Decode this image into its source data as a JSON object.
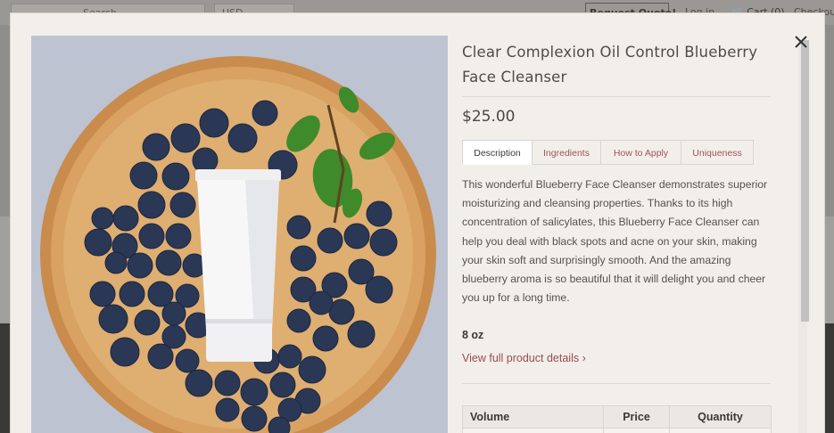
{
  "background": {
    "search_placeholder": "Search...",
    "currency": "USD",
    "request_quote": "Request Quote!",
    "login": "Log in",
    "cart": "Cart (0)",
    "checkout": "Checkout"
  },
  "product": {
    "title": "Clear Complexion Oil Control Blueberry Face Cleanser",
    "price": "$25.00",
    "tabs": [
      {
        "label": "Description",
        "active": true
      },
      {
        "label": "Ingredients",
        "active": false
      },
      {
        "label": "How to Apply",
        "active": false
      },
      {
        "label": "Uniqueness",
        "active": false
      }
    ],
    "description": "This wonderful Blueberry Face Cleanser demonstrates superior moisturizing and cleansing properties. Thanks to its high concentration of salicylates, this Blueberry Face Cleanser can help you deal with black spots and acne on your skin, making your skin soft and surprisingly smooth. And the amazing blueberry aroma is so beautiful that it will delight you and cheer you up for a long time.",
    "size": "8 oz",
    "details_link": "View full product details ›",
    "table_headers": {
      "volume": "Volume",
      "price": "Price",
      "quantity": "Quantity"
    }
  },
  "icons": {
    "close": "close-icon",
    "cart": "cart-icon"
  },
  "colors": {
    "link": "#9a4a55",
    "modal_bg": "#f2efea",
    "text": "#55514d"
  }
}
